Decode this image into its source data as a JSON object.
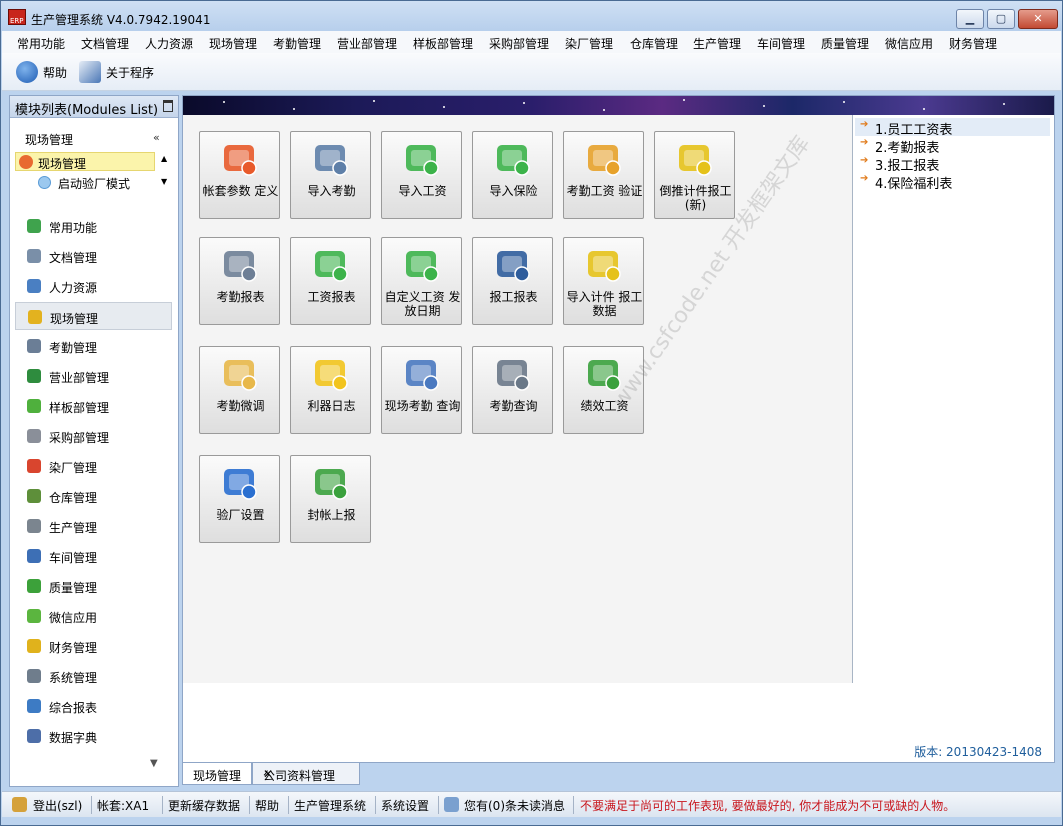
{
  "window": {
    "title": "生产管理系统 V4.0.7942.19041",
    "app_icon_text": "ERP",
    "btn_min": "▁",
    "btn_max": "▢",
    "btn_close": "✕"
  },
  "menubar": [
    "常用功能",
    "文档管理",
    "人力资源",
    "现场管理",
    "考勤管理",
    "营业部管理",
    "样板部管理",
    "采购部管理",
    "染厂管理",
    "仓库管理",
    "生产管理",
    "车间管理",
    "质量管理",
    "微信应用",
    "财务管理"
  ],
  "toolbar": {
    "help_label": "帮助",
    "about_label": "关于程序"
  },
  "sidebar": {
    "title": "模块列表(Modules List)",
    "section_title": "现场管理",
    "collapse_glyph": "«",
    "tree_selected": "现场管理",
    "tree_sub": "启动验厂模式",
    "scroll_up": "▲",
    "scroll_down": "▼",
    "nav_items": [
      {
        "label": "常用功能",
        "icon": "star-icon",
        "color": "#3fa34d"
      },
      {
        "label": "文档管理",
        "icon": "clock-icon",
        "color": "#7a8fa8"
      },
      {
        "label": "人力资源",
        "icon": "users-icon",
        "color": "#4a7fc2"
      },
      {
        "label": "现场管理",
        "icon": "crown-icon",
        "color": "#e3b21f"
      },
      {
        "label": "考勤管理",
        "icon": "timer-icon",
        "color": "#6b7e96"
      },
      {
        "label": "营业部管理",
        "icon": "globe-icon",
        "color": "#2e8c3e"
      },
      {
        "label": "样板部管理",
        "icon": "puzzle-icon",
        "color": "#4fb03d"
      },
      {
        "label": "采购部管理",
        "icon": "book-icon",
        "color": "#8a8f99"
      },
      {
        "label": "染厂管理",
        "icon": "pie-icon",
        "color": "#d9452e"
      },
      {
        "label": "仓库管理",
        "icon": "box-icon",
        "color": "#5e8f3a"
      },
      {
        "label": "生产管理",
        "icon": "wrench-icon",
        "color": "#7b858f"
      },
      {
        "label": "车间管理",
        "icon": "org-icon",
        "color": "#3d6fb5"
      },
      {
        "label": "质量管理",
        "icon": "flag-icon",
        "color": "#3ca13a"
      },
      {
        "label": "微信应用",
        "icon": "wechat-icon",
        "color": "#5bb53f"
      },
      {
        "label": "财务管理",
        "icon": "shield-icon",
        "color": "#e0b21c"
      },
      {
        "label": "系统管理",
        "icon": "tools-icon",
        "color": "#6f7d8c"
      },
      {
        "label": "综合报表",
        "icon": "bar-chart-icon",
        "color": "#3d7bc4"
      },
      {
        "label": "数据字典",
        "icon": "dictionary-icon",
        "color": "#4d6ea8"
      }
    ]
  },
  "tiles": [
    {
      "label": "帐套参数 定义",
      "icon": "settings-gear-icon",
      "color": "#e85a2a"
    },
    {
      "label": "导入考勤",
      "icon": "binoculars-icon",
      "color": "#5e7fa8"
    },
    {
      "label": "导入工资",
      "icon": "money-person-icon",
      "color": "#3cb34a"
    },
    {
      "label": "导入保险",
      "icon": "money-coins-icon",
      "color": "#3cb34a"
    },
    {
      "label": "考勤工资 验证",
      "icon": "calculator-icon",
      "color": "#e7a22b"
    },
    {
      "label": "倒推计件报工 (新)",
      "icon": "cubes-hand-icon",
      "color": "#e5c21a"
    },
    {
      "label": "考勤报表",
      "icon": "clock-report-icon",
      "color": "#6e7f96"
    },
    {
      "label": "工资报表",
      "icon": "money-report-icon",
      "color": "#3cb34a"
    },
    {
      "label": "自定义工资 发放日期",
      "icon": "money-calendar-icon",
      "color": "#3cb34a"
    },
    {
      "label": "报工报表",
      "icon": "clipboard-pen-icon",
      "color": "#2f5d9c"
    },
    {
      "label": "导入计件 报工数据",
      "icon": "cubes-import-icon",
      "color": "#e5c21a"
    },
    {
      "label": "考勤微调",
      "icon": "folder-gear-icon",
      "color": "#e8b84a"
    },
    {
      "label": "利器日志",
      "icon": "warning-icon",
      "color": "#f2c41d"
    },
    {
      "label": "现场考勤 查询",
      "icon": "network-users-icon",
      "color": "#4a79c0"
    },
    {
      "label": "考勤查询",
      "icon": "database-search-icon",
      "color": "#6a7888"
    },
    {
      "label": "绩效工资",
      "icon": "checklist-icon",
      "color": "#3aa13d"
    },
    {
      "label": "验厂设置",
      "icon": "accessibility-icon",
      "color": "#2a6fd0"
    },
    {
      "label": "封帐上报",
      "icon": "document-check-icon",
      "color": "#3aa13d"
    }
  ],
  "reports": [
    "1.员工工资表",
    "2.考勤报表",
    "3.报工报表",
    "4.保险福利表"
  ],
  "watermark": "www.csfcode.net 开发框架文库",
  "version": "版本: 20130423-1408",
  "tabs": [
    {
      "label": "现场管理"
    },
    {
      "label": "公司资料管理",
      "close": "✕"
    }
  ],
  "statusbar": {
    "login": "登出(szl)",
    "account": "帐套:XA1",
    "refresh_cache": "更新缓存数据",
    "help": "帮助",
    "system_name": "生产管理系统",
    "system_settings": "系统设置",
    "messages": "您有(0)条未读消息",
    "motto": "不要满足于尚可的工作表现, 要做最好的, 你才能成为不可或缺的人物。",
    "motto_color": "#c8161d"
  }
}
